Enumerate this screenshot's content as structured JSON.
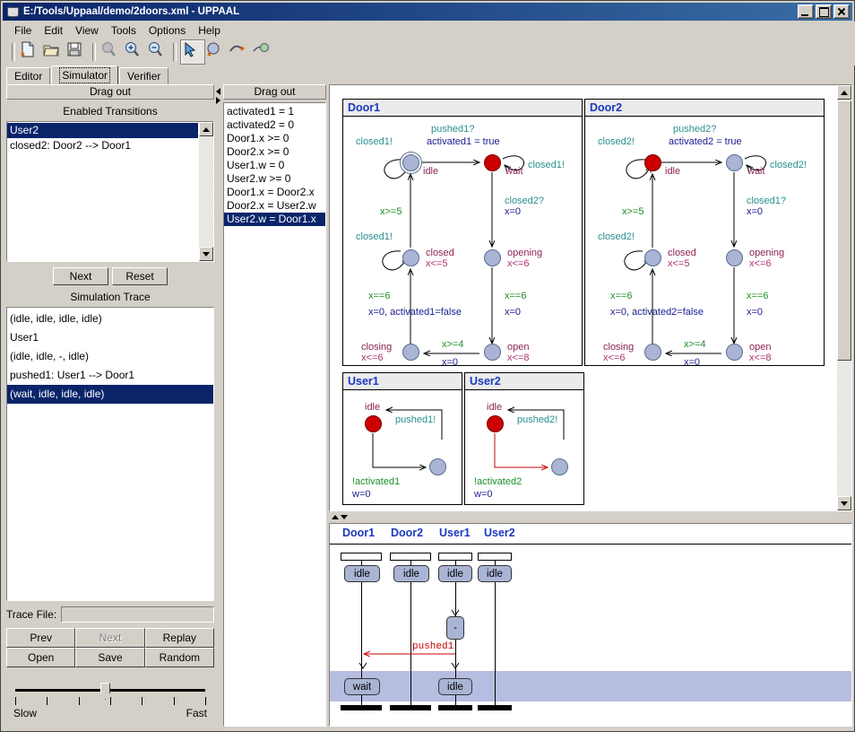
{
  "window": {
    "title": "E:/Tools/Uppaal/demo/2doors.xml - UPPAAL",
    "icon": "uppaal-cup-icon",
    "minimize": "minimize-button",
    "maximize": "maximize-button",
    "close": "close-button"
  },
  "menu": [
    "File",
    "Edit",
    "View",
    "Tools",
    "Options",
    "Help"
  ],
  "toolbar": [
    {
      "name": "new-document-icon",
      "disabled": false
    },
    {
      "name": "open-folder-icon",
      "disabled": false
    },
    {
      "name": "save-disk-icon",
      "disabled": false
    },
    {
      "name": "zoom-icon",
      "disabled": true
    },
    {
      "name": "zoom-in-icon",
      "disabled": false
    },
    {
      "name": "zoom-out-icon",
      "disabled": false
    },
    {
      "name": "select-pointer-icon",
      "disabled": false,
      "selected": true
    },
    {
      "name": "add-location-icon",
      "disabled": false
    },
    {
      "name": "add-edge-icon",
      "disabled": false
    },
    {
      "name": "add-nail-icon",
      "disabled": false
    }
  ],
  "tabs": [
    {
      "label": "Editor",
      "active": false
    },
    {
      "label": "Simulator",
      "active": true
    },
    {
      "label": "Verifier",
      "active": false
    }
  ],
  "left_panel": {
    "drag_out": "Drag out",
    "enabled_transitions_title": "Enabled Transitions",
    "enabled_transitions": [
      {
        "text": "User2",
        "selected": true
      },
      {
        "text": "closed2: Door2 --> Door1",
        "selected": false
      }
    ],
    "next_label": "Next",
    "reset_label": "Reset",
    "simulation_trace_title": "Simulation Trace",
    "simulation_trace": [
      {
        "text": "(idle, idle, idle, idle)",
        "selected": false
      },
      {
        "text": "User1",
        "selected": false
      },
      {
        "text": "(idle, idle, -, idle)",
        "selected": false
      },
      {
        "text": "pushed1: User1 --> Door1",
        "selected": false
      },
      {
        "text": "(wait, idle, idle, idle)",
        "selected": true
      }
    ],
    "trace_file_label": "Trace File:",
    "trace_file_value": "",
    "buttons": [
      {
        "label": "Prev",
        "disabled": false
      },
      {
        "label": "Next",
        "disabled": true
      },
      {
        "label": "Replay",
        "disabled": false
      },
      {
        "label": "Open",
        "disabled": false
      },
      {
        "label": "Save",
        "disabled": false
      },
      {
        "label": "Random",
        "disabled": false
      }
    ],
    "speed_slow": "Slow",
    "speed_fast": "Fast",
    "speed_ticks": 7,
    "speed_value": 3
  },
  "variables_panel": {
    "drag_out": "Drag out",
    "items": [
      {
        "text": "activated1 = 1",
        "selected": false
      },
      {
        "text": "activated2 = 0",
        "selected": false
      },
      {
        "text": "Door1.x >= 0",
        "selected": false
      },
      {
        "text": "Door2.x >= 0",
        "selected": false
      },
      {
        "text": "User1.w = 0",
        "selected": false
      },
      {
        "text": "User2.w >= 0",
        "selected": false
      },
      {
        "text": "Door1.x = Door2.x",
        "selected": false
      },
      {
        "text": "Door2.x = User2.w",
        "selected": false
      },
      {
        "text": "User2.w = Door1.x",
        "selected": true
      }
    ]
  },
  "automata": [
    {
      "title": "Door1",
      "nodes": [
        {
          "id": "idle",
          "label": "idle",
          "invariant": "",
          "active": false,
          "initial": true
        },
        {
          "id": "wait",
          "label": "wait",
          "invariant": "",
          "active": true,
          "initial": false
        },
        {
          "id": "closed",
          "label": "closed",
          "invariant": "x<=5",
          "active": false,
          "initial": false
        },
        {
          "id": "opening",
          "label": "opening",
          "invariant": "x<=6",
          "active": false,
          "initial": false
        },
        {
          "id": "closing",
          "label": "closing",
          "invariant": "x<=6",
          "active": false,
          "initial": false
        },
        {
          "id": "open",
          "label": "open",
          "invariant": "x<=8",
          "active": false,
          "initial": false
        }
      ],
      "edges": [
        {
          "sync": "closed1!",
          "guard": "",
          "update": ""
        },
        {
          "sync": "pushed1?",
          "guard": "",
          "update": "activated1 = true"
        },
        {
          "sync": "closed1!",
          "guard": "",
          "update": ""
        },
        {
          "sync": "closed2?",
          "guard": "",
          "update": "x=0"
        },
        {
          "sync": "",
          "guard": "x>=5",
          "update": ""
        },
        {
          "sync": "closed1!",
          "guard": "",
          "update": ""
        },
        {
          "sync": "",
          "guard": "x==6",
          "update": "x=0, activated1=false"
        },
        {
          "sync": "",
          "guard": "x==6",
          "update": "x=0"
        },
        {
          "sync": "",
          "guard": "x>=4",
          "update": "x=0"
        }
      ]
    },
    {
      "title": "Door2",
      "nodes": [
        {
          "id": "idle",
          "label": "idle",
          "invariant": "",
          "active": true,
          "initial": false
        },
        {
          "id": "wait",
          "label": "wait",
          "invariant": "",
          "active": false,
          "initial": false
        },
        {
          "id": "closed",
          "label": "closed",
          "invariant": "x<=5",
          "active": false,
          "initial": false
        },
        {
          "id": "opening",
          "label": "opening",
          "invariant": "x<=6",
          "active": false,
          "initial": false
        },
        {
          "id": "closing",
          "label": "closing",
          "invariant": "x<=6",
          "active": false,
          "initial": false
        },
        {
          "id": "open",
          "label": "open",
          "invariant": "x<=8",
          "active": false,
          "initial": false
        }
      ],
      "edges": [
        {
          "sync": "closed2!",
          "guard": "",
          "update": ""
        },
        {
          "sync": "pushed2?",
          "guard": "",
          "update": "activated2 = true"
        },
        {
          "sync": "closed2!",
          "guard": "",
          "update": ""
        },
        {
          "sync": "closed1?",
          "guard": "",
          "update": "x=0"
        },
        {
          "sync": "",
          "guard": "x>=5",
          "update": ""
        },
        {
          "sync": "closed2!",
          "guard": "",
          "update": ""
        },
        {
          "sync": "",
          "guard": "x==6",
          "update": "x=0, activated2=false"
        },
        {
          "sync": "",
          "guard": "x==6",
          "update": "x=0"
        },
        {
          "sync": "",
          "guard": "x>=4",
          "update": "x=0"
        }
      ]
    },
    {
      "title": "User1",
      "nodes": [
        {
          "id": "idle",
          "label": "idle",
          "invariant": "",
          "active": true,
          "initial": false
        },
        {
          "id": "ready",
          "label": "",
          "invariant": "",
          "active": false,
          "initial": false
        }
      ],
      "edges": [
        {
          "sync": "pushed1!",
          "guard": "",
          "update": ""
        },
        {
          "sync": "",
          "guard": "!activated1",
          "update": "w=0"
        }
      ]
    },
    {
      "title": "User2",
      "nodes": [
        {
          "id": "idle",
          "label": "idle",
          "invariant": "",
          "active": true,
          "initial": false
        },
        {
          "id": "ready",
          "label": "",
          "invariant": "",
          "active": false,
          "initial": false
        }
      ],
      "edges": [
        {
          "sync": "pushed2!",
          "guard": "",
          "update": ""
        },
        {
          "sync": "",
          "guard": "!activated2",
          "update": "w=0"
        }
      ]
    }
  ],
  "msc": {
    "columns": [
      "Door1",
      "Door2",
      "User1",
      "User2"
    ],
    "rows": [
      {
        "states": [
          "idle",
          "idle",
          "idle",
          "idle"
        ],
        "highlighted": false
      },
      {
        "states": [
          "",
          "",
          "-",
          ""
        ],
        "highlighted": false
      },
      {
        "states": [
          "wait",
          "",
          "idle",
          ""
        ],
        "highlighted": true
      }
    ],
    "messages": [
      {
        "label": "pushed1",
        "from": "User1",
        "to": "Door1"
      }
    ]
  },
  "colors": {
    "active_state": "#cc0000",
    "state": "#aab4d4",
    "title_text": "#1a39c0",
    "sync_text": "#2a8f8f",
    "guard_text": "#1a8f2a",
    "update_text": "#1a1a8f",
    "invariant_text": "#b03070",
    "name_text": "#8b2252",
    "selection": "#0a246a",
    "msc_highlight": "#b6bde0",
    "message": "#cc0000"
  }
}
